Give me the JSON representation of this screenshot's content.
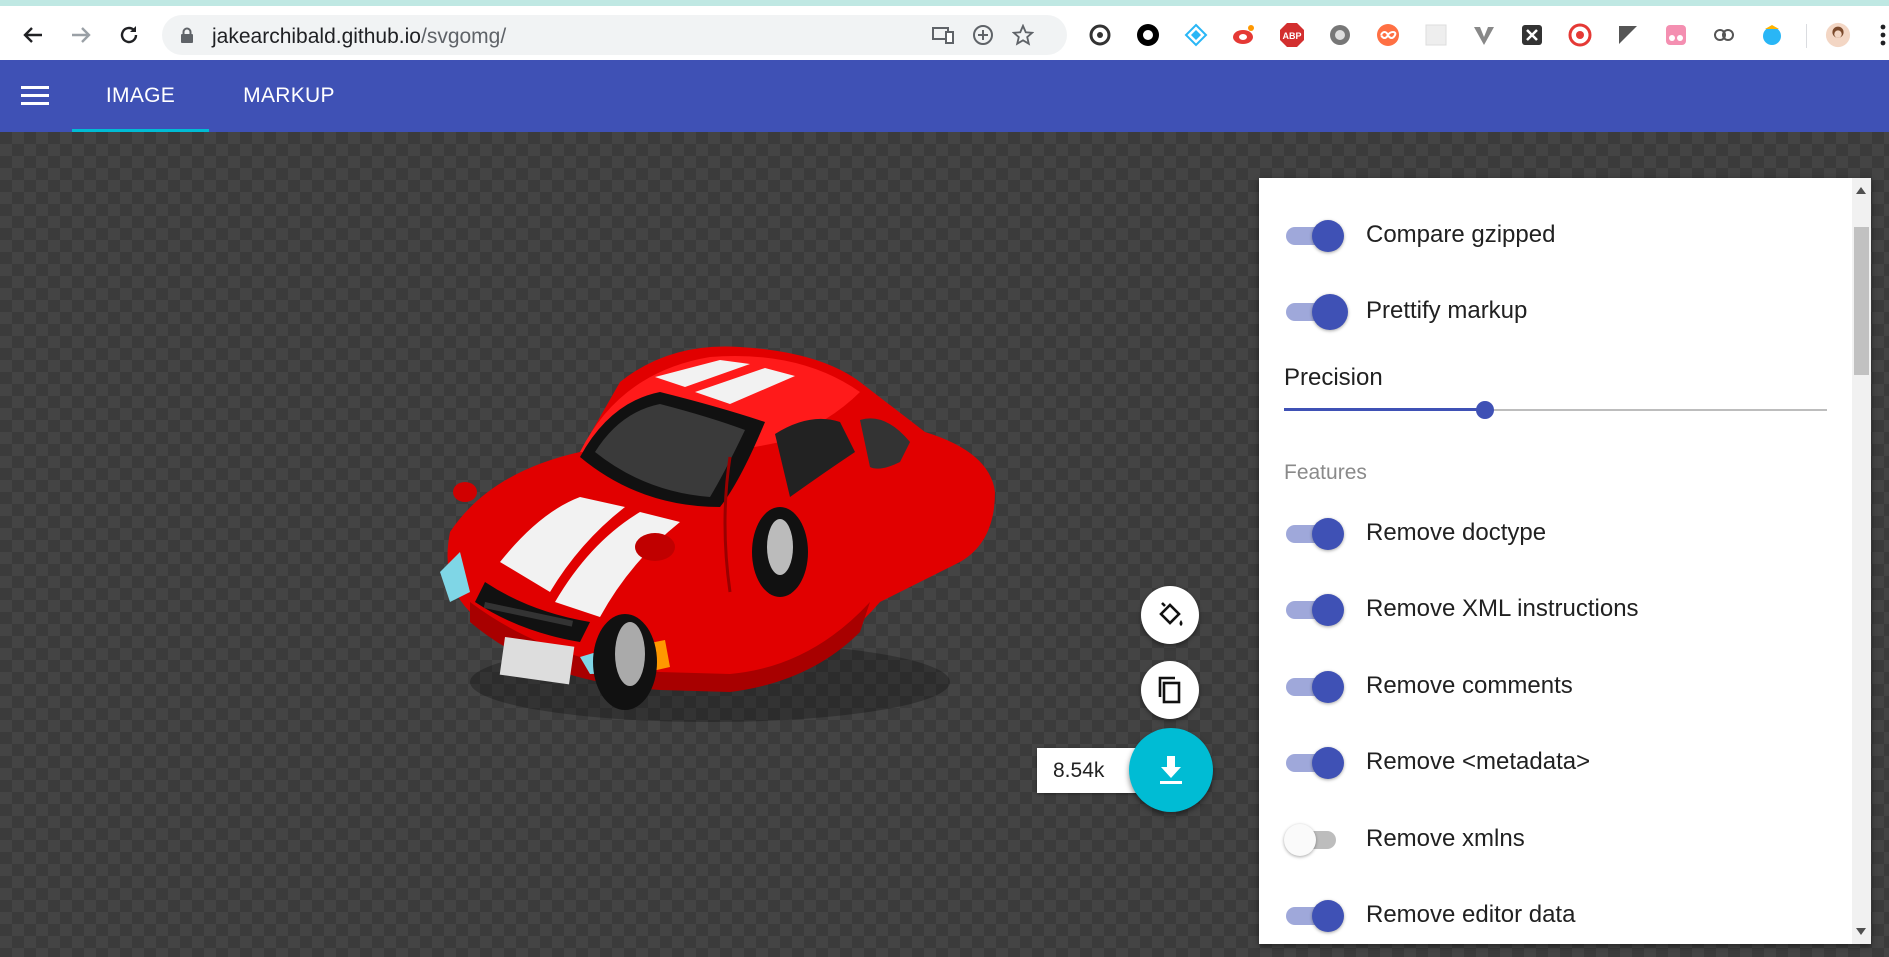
{
  "browser": {
    "url_host": "jakearchibald.github.io",
    "url_path": "/svgomg/"
  },
  "app": {
    "tabs": [
      {
        "label": "IMAGE",
        "active": true
      },
      {
        "label": "MARKUP",
        "active": false
      }
    ],
    "accent_color": "#3f51b5",
    "fab_color": "#00bcd4"
  },
  "output": {
    "size_label": "8.54k"
  },
  "settings": {
    "toggles_top": [
      {
        "label": "Compare gzipped",
        "on": true
      },
      {
        "label": "Prettify markup",
        "on": true
      }
    ],
    "precision_label": "Precision",
    "precision_fraction": 0.37,
    "features_heading": "Features",
    "features": [
      {
        "label": "Remove doctype",
        "on": true
      },
      {
        "label": "Remove XML instructions",
        "on": true
      },
      {
        "label": "Remove comments",
        "on": true
      },
      {
        "label": "Remove <metadata>",
        "on": true
      },
      {
        "label": "Remove xmlns",
        "on": false
      },
      {
        "label": "Remove editor data",
        "on": true
      }
    ]
  }
}
